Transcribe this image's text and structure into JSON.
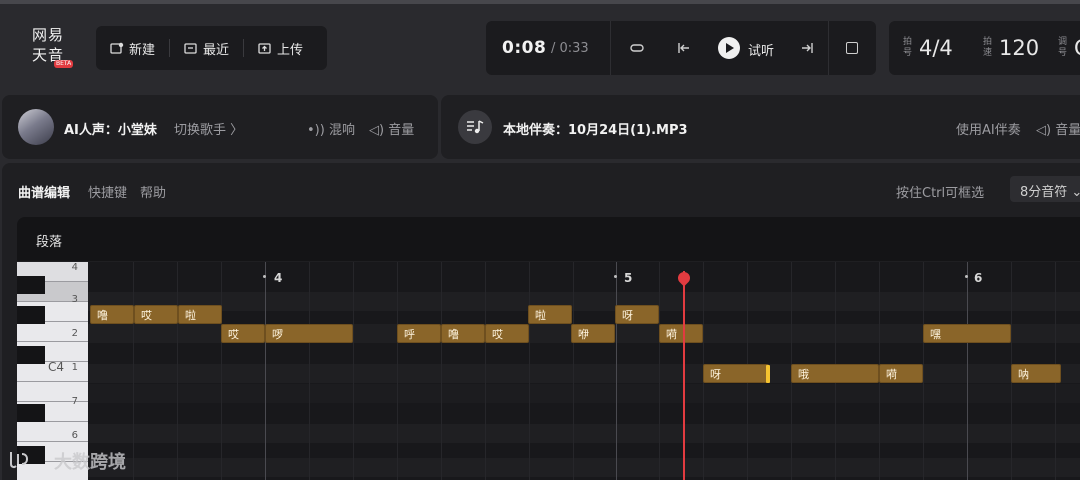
{
  "app": {
    "logo_line1": "网易",
    "logo_line2": "天音",
    "logo_badge": "BETA"
  },
  "filebar": {
    "new_label": "新建",
    "recent_label": "最近",
    "upload_label": "上传"
  },
  "transport": {
    "current_time": "0:08",
    "total_time": "/ 0:33",
    "try_label": "试听"
  },
  "params": {
    "meter_label": "拍号",
    "meter_value": "4/4",
    "tempo_label": "拍速",
    "tempo_value": "120",
    "key_label": "调号",
    "key_value": "C"
  },
  "vocal": {
    "name": "AI人声：小堂妹",
    "switch_label": "切换歌手 〉",
    "reverb_label": "混响",
    "volume_label": "音量"
  },
  "accompaniment": {
    "name": "本地伴奏：10月24日(1).MP3",
    "ai_label": "使用AI伴奏",
    "volume_label": "音量"
  },
  "editor": {
    "tabs": [
      "曲谱编辑",
      "快捷键",
      "帮助"
    ],
    "ctrl_hint": "按住Ctrl可框选",
    "note_value": "8分音符",
    "section_label": "段落"
  },
  "piano_labels": [
    "4",
    "3",
    "2",
    "C4",
    "1",
    "7",
    "6"
  ],
  "bars": [
    "4",
    "5",
    "6"
  ],
  "notes": [
    {
      "text": "噜"
    },
    {
      "text": "哎"
    },
    {
      "text": "啦"
    },
    {
      "text": "啦"
    },
    {
      "text": "呀"
    },
    {
      "text": "哎"
    },
    {
      "text": "啰"
    },
    {
      "text": "呼"
    },
    {
      "text": "噜"
    },
    {
      "text": "哎"
    },
    {
      "text": "咿"
    },
    {
      "text": "嗬"
    },
    {
      "text": "嘿"
    },
    {
      "text": "呀"
    },
    {
      "text": "哦"
    },
    {
      "text": "嗬"
    },
    {
      "text": "呐"
    }
  ],
  "watermark": "大数跨境",
  "colors": {
    "note_fill": "#8a6529",
    "playhead": "#e23b40",
    "selection": "#f5c330"
  }
}
